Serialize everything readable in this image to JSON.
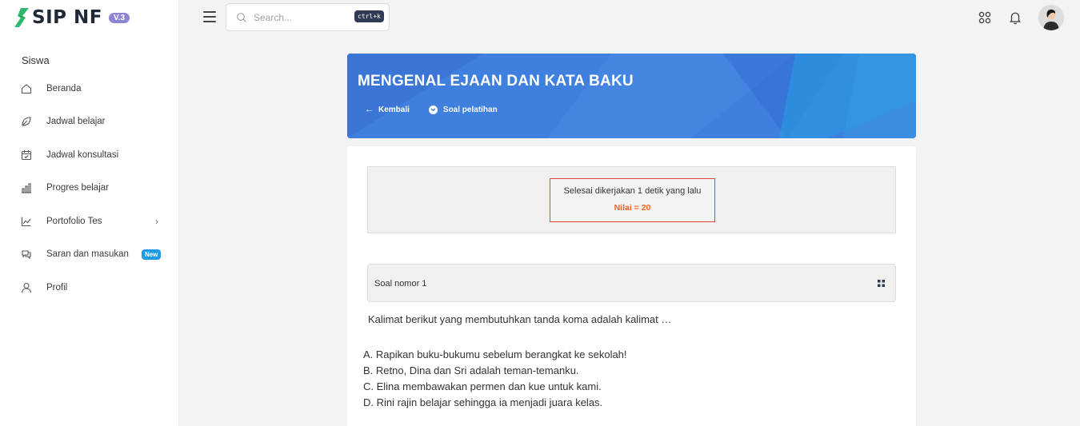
{
  "app": {
    "logo_text": "SIP NF",
    "version_badge": "V.3",
    "brand_colors": {
      "logo_green": "#2eb86e",
      "banner_blue": "#3f7fde",
      "badge_blue": "#1e9be6",
      "score_orange": "#f06419",
      "result_border": "#e0443c"
    }
  },
  "sidebar": {
    "section_title": "Siswa",
    "items": [
      {
        "label": "Beranda",
        "icon": "home-icon"
      },
      {
        "label": "Jadwal belajar",
        "icon": "leaf-icon"
      },
      {
        "label": "Jadwal konsultasi",
        "icon": "calendar-check-icon"
      },
      {
        "label": "Progres belajar",
        "icon": "bar-chart-icon"
      },
      {
        "label": "Portofolio Tes",
        "icon": "line-chart-icon",
        "chevron": "›"
      },
      {
        "label": "Saran dan masukan",
        "icon": "chat-icon",
        "badge": "New"
      },
      {
        "label": "Profil",
        "icon": "user-icon"
      }
    ]
  },
  "topbar": {
    "search_placeholder": "Search...",
    "search_shortcut": "ctrl+k",
    "icons": [
      "menu-icon",
      "search-icon",
      "apps-icon",
      "bell-icon",
      "avatar"
    ]
  },
  "header": {
    "title": "MENGENAL EJAAN DAN KATA BAKU",
    "back_label": "Kembali",
    "dropdown_label": "Soal pelatihan"
  },
  "result": {
    "status_text": "Selesai dikerjakan 1 detik yang lalu",
    "score_text": "Nilai = 20"
  },
  "question": {
    "header_label": "Soal nomor 1",
    "text": "Kalimat berikut yang membutuhkan tanda koma adalah kalimat …",
    "options": [
      "A. Rapikan buku-bukumu sebelum berangkat ke sekolah!",
      "B. Retno, Dina dan Sri adalah teman-temanku.",
      "C. Elina membawakan permen dan kue untuk kami.",
      "D. Rini rajin belajar sehingga ia menjadi juara kelas."
    ]
  }
}
